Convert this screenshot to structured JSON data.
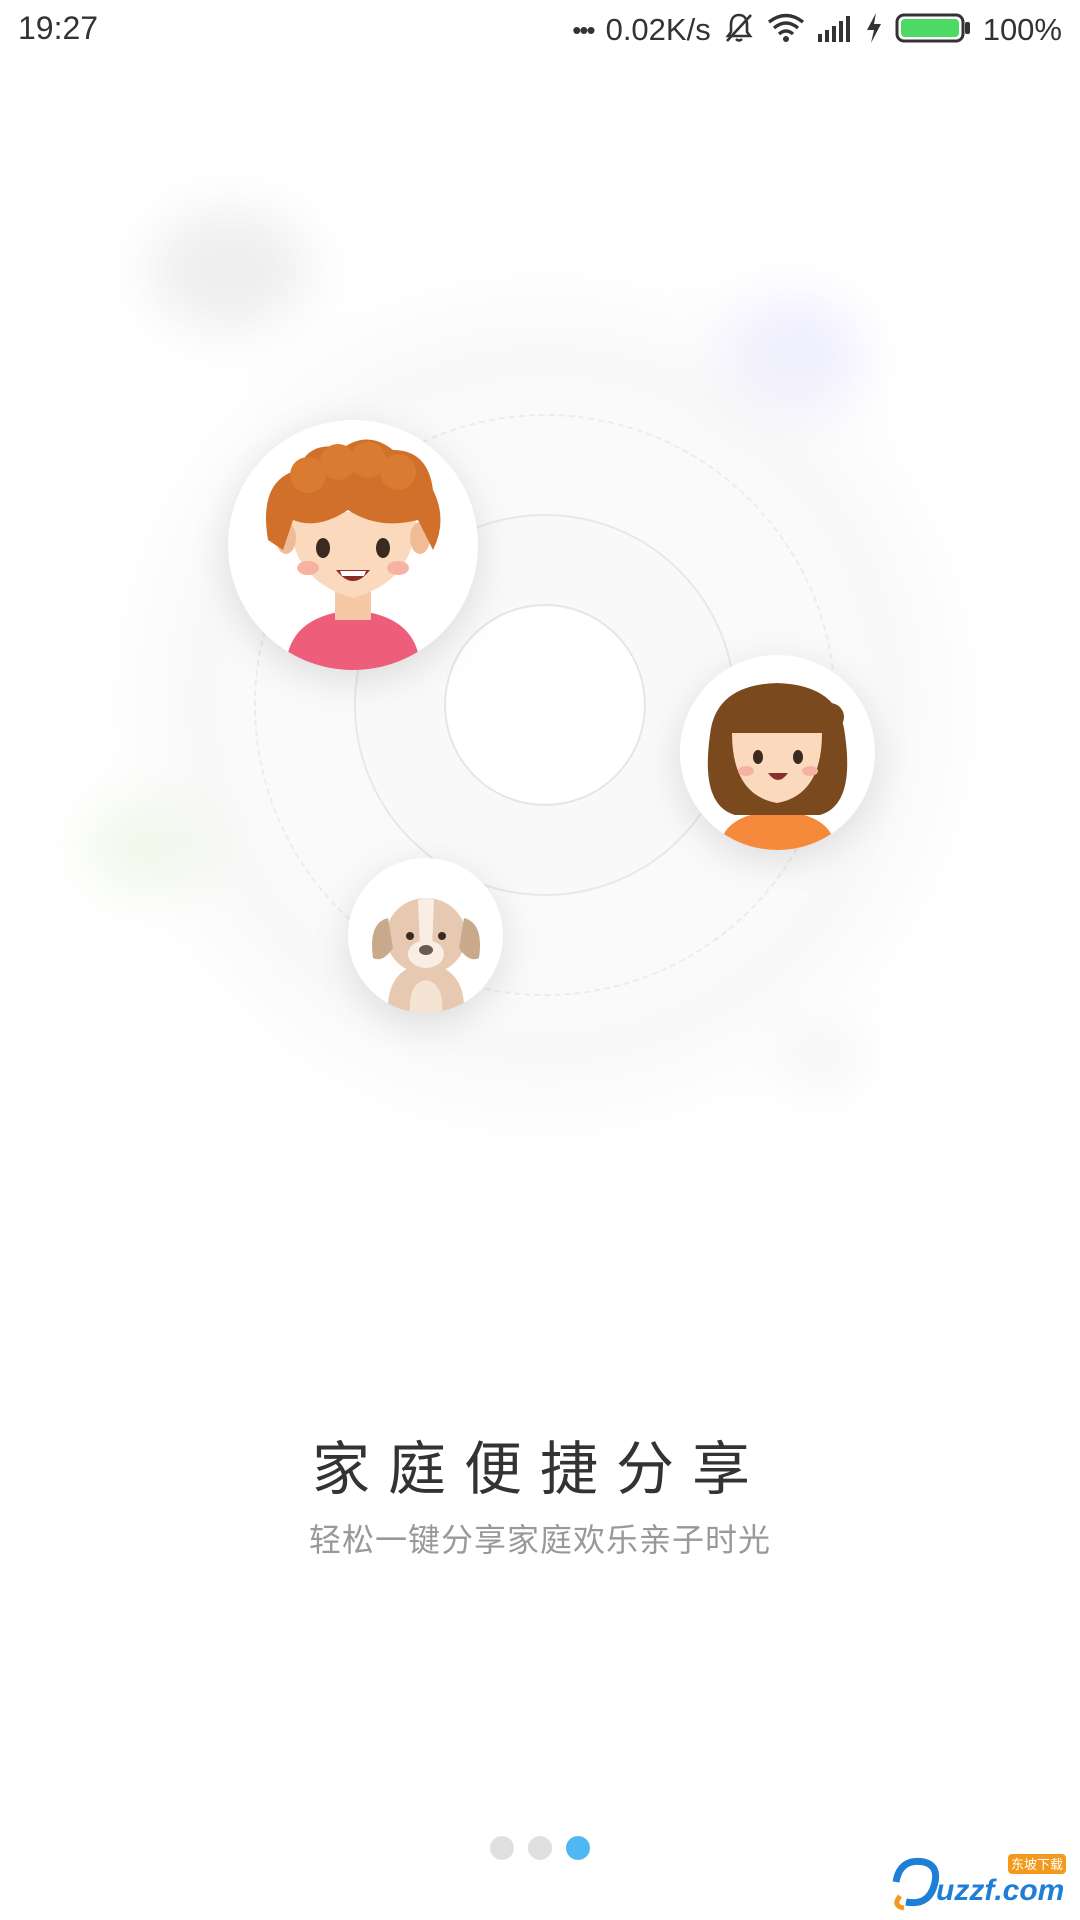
{
  "status_bar": {
    "time": "19:27",
    "dots": "•••",
    "network_speed": "0.02K/s",
    "battery_percent": "100%",
    "battery_level": 1.0,
    "icons": [
      "mute-icon",
      "wifi-icon",
      "signal-icon",
      "charging-icon",
      "battery-icon"
    ]
  },
  "onboarding": {
    "title": "家庭便捷分享",
    "subtitle": "轻松一键分享家庭欢乐亲子时光",
    "page_count": 3,
    "current_page": 3
  },
  "illustration": {
    "avatars": [
      "boy-avatar",
      "girl-avatar",
      "dog-avatar"
    ]
  },
  "watermark": {
    "brand": "uzzf.com",
    "tag": "东坡下载"
  },
  "colors": {
    "accent": "#4fb7f2",
    "dot_inactive": "#e0e0e0",
    "title": "#333333",
    "subtitle": "#999999"
  }
}
